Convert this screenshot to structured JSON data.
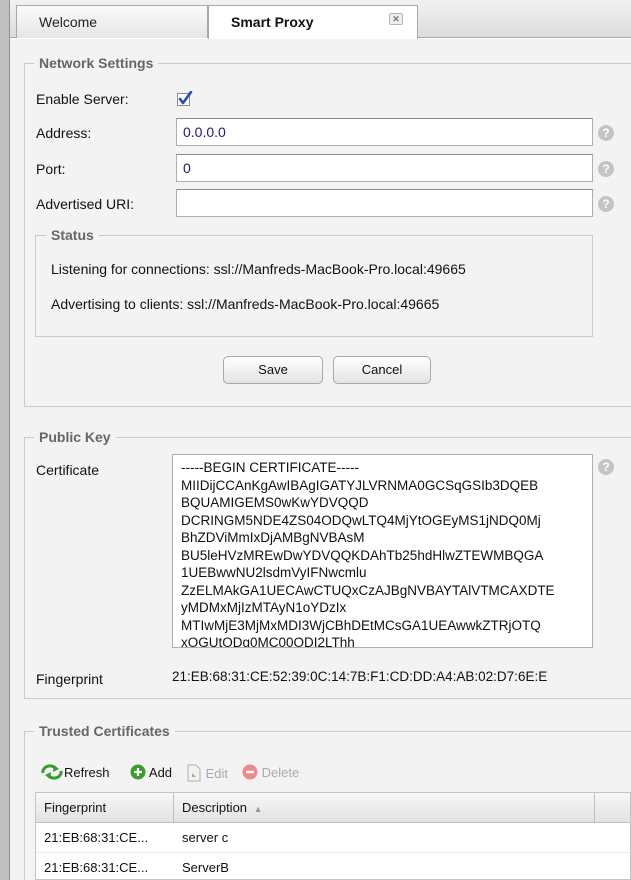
{
  "tabs": [
    {
      "label": "Welcome"
    },
    {
      "label": "Smart Proxy",
      "close_icon": "close-icon"
    }
  ],
  "network_settings": {
    "legend": "Network Settings",
    "enable_server_label": "Enable Server:",
    "enable_server_checked": true,
    "address_label": "Address:",
    "address_value": "0.0.0.0",
    "port_label": "Port:",
    "port_value": "0",
    "advertised_uri_label": "Advertised URI:",
    "advertised_uri_value": "",
    "help_icon": "?",
    "status": {
      "legend": "Status",
      "listening": "Listening for connections: ssl://Manfreds-MacBook-Pro.local:49665",
      "advertising": "Advertising to clients: ssl://Manfreds-MacBook-Pro.local:49665"
    },
    "save_label": "Save",
    "cancel_label": "Cancel"
  },
  "public_key": {
    "legend": "Public Key",
    "certificate_label": "Certificate",
    "certificate_text": "-----BEGIN CERTIFICATE-----\nMIIDijCCAnKgAwIBAgIGATYJLVRNMA0GCSqGSIb3DQEB\nBQUAMIGEMS0wKwYDVQQD\nDCRINGM5NDE4ZS04ODQwLTQ4MjYtOGEyMS1jNDQ0Mj\nBhZDViMmIxDjAMBgNVBAsM\nBU5leHVzMREwDwYDVQQKDAhTb25hdHlwZTEWMBQGA\n1UEBwwNU2lsdmVyIFNwcmlu\nZzELMAkGA1UECAwCTUQxCzAJBgNVBAYTAlVTMCAXDTE\nyMDMxMjIzMTAyN1oYDzIx\nMTIwMjE3MjMxMDI3WjCBhDEtMCsGA1UEAwwkZTRjOTQ\nxOGUtODg0MC00ODI2LThh",
    "fingerprint_label": "Fingerprint",
    "fingerprint_value": "21:EB:68:31:CE:52:39:0C:14:7B:F1:CD:DD:A4:AB:02:D7:6E:E"
  },
  "trusted_certificates": {
    "legend": "Trusted Certificates",
    "toolbar": {
      "refresh": "Refresh",
      "add": "Add",
      "edit": "Edit",
      "delete": "Delete"
    },
    "columns": [
      "Fingerprint",
      "Description"
    ],
    "sort_indicator": "▲",
    "rows": [
      {
        "fingerprint": "21:EB:68:31:CE...",
        "description": "server c"
      },
      {
        "fingerprint": "21:EB:68:31:CE...",
        "description": "ServerB"
      }
    ]
  },
  "colors": {
    "legend": "#666666",
    "accent_blue": "#1f4fb8",
    "add_green": "#3a9b2e",
    "delete_red": "#e05a5a"
  }
}
